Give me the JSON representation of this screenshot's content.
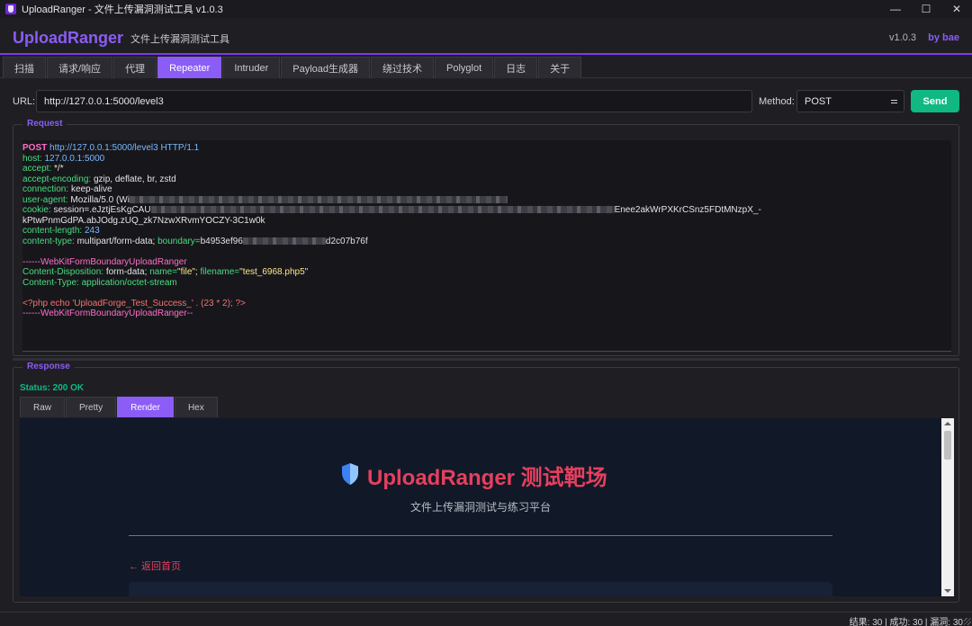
{
  "window": {
    "title": "UploadRanger - 文件上传漏洞测试工具 v1.0.3",
    "minimize": "—",
    "maximize": "☐",
    "close": "✕"
  },
  "header": {
    "brand": "UploadRanger",
    "subtitle": "文件上传漏洞测试工具",
    "version": "v1.0.3",
    "author": "by bae",
    "accent": "#8b5cf6"
  },
  "tabs": [
    {
      "label": "扫描"
    },
    {
      "label": "请求/响应"
    },
    {
      "label": "代理"
    },
    {
      "label": "Repeater",
      "active": true
    },
    {
      "label": "Intruder"
    },
    {
      "label": "Payload生成器"
    },
    {
      "label": "绕过技术"
    },
    {
      "label": "Polyglot"
    },
    {
      "label": "日志"
    },
    {
      "label": "关于"
    }
  ],
  "url_row": {
    "url_label": "URL:",
    "url_value": "http://127.0.0.1:5000/level3",
    "method_label": "Method:",
    "method_value": "POST",
    "send_label": "Send",
    "send_color": "#10b981"
  },
  "request": {
    "title": "Request",
    "request_line": {
      "method": "POST",
      "url": "http://127.0.0.1:5000/level3",
      "version": "HTTP/1.1"
    },
    "host_name": "host:",
    "host_value": "127.0.0.1:5000",
    "accept_name": "accept:",
    "accept_value": "*/*",
    "encoding_name": "accept-encoding:",
    "encoding_value": "gzip, deflate, br, zstd",
    "connection_name": "connection:",
    "connection_value": "keep-alive",
    "ua_name": "user-agent:",
    "ua_value": "Mozilla/5.0 (Wi",
    "cookie_name": "cookie:",
    "cookie_start": "session=.eJztjEsKgCAU",
    "cookie_end": "Enee2akWrPXKrCSnz5FDtMNzpX_-",
    "cookie_cont": "kPtwPnmGdPA.abJOdg.zUQ_zk7NzwXRvmYOCZY-3C1w0k",
    "length_name": "content-length:",
    "length_value": "243",
    "ctype_name": "content-type:",
    "ctype_value": "multipart/form-data;",
    "boundary_name": "boundary=",
    "boundary_start": "b4953ef96",
    "boundary_end": "d2c07b76f",
    "boundary_line": "------WebKitFormBoundaryUploadRanger",
    "disp_name": "Content-Disposition:",
    "disp_value": "form-data;",
    "disp_field_name": "name=",
    "disp_field_value": "\"file\";",
    "disp_file_name": "filename=",
    "disp_file_value": "\"test_6968.php5\"",
    "part_ctype_name": "Content-Type:",
    "part_ctype_value": "application/octet-stream",
    "php_line": "<?php echo 'UploadForge_Test_Success_' . (23 * 2); ?>",
    "boundary_close": "------WebKitFormBoundaryUploadRanger--"
  },
  "response": {
    "title": "Response",
    "status": "Status: 200 OK",
    "subtabs": [
      {
        "label": "Raw"
      },
      {
        "label": "Pretty"
      },
      {
        "label": "Render",
        "active": true
      },
      {
        "label": "Hex"
      }
    ],
    "render": {
      "heading": "UploadRanger 测试靶场",
      "subheading": "文件上传漏洞测试与练习平台",
      "back_link": "← 返回首页",
      "heading_color": "#e5405e"
    }
  },
  "statusbar": {
    "text": "结果: 30 | 成功: 30 | 漏洞: 30"
  }
}
